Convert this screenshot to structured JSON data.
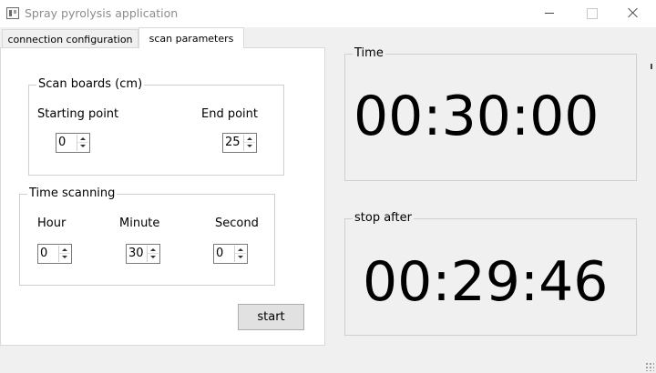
{
  "window": {
    "title": "Spray pyrolysis application"
  },
  "tabs": [
    {
      "label": "connection configuration",
      "active": false
    },
    {
      "label": "scan parameters",
      "active": true
    }
  ],
  "scan_boards": {
    "title": "Scan boards (cm)",
    "starting_point_label": "Starting point",
    "starting_point_value": "0",
    "end_point_label": "End point",
    "end_point_value": "25"
  },
  "time_scanning": {
    "title": "Time scanning",
    "hour_label": "Hour",
    "hour_value": "0",
    "minute_label": "Minute",
    "minute_value": "30",
    "second_label": "Second",
    "second_value": "0"
  },
  "start_button": {
    "label": "start"
  },
  "time_display": {
    "title": "Time",
    "value": "00:30:00"
  },
  "stop_after_display": {
    "title": "stop after",
    "value": "00:29:46"
  },
  "colors": {
    "window_bg": "#f0f0f0",
    "panel_bg": "#ffffff",
    "button_bg": "#e1e1e1",
    "text": "#000000",
    "title_text": "#8c8c8c"
  }
}
